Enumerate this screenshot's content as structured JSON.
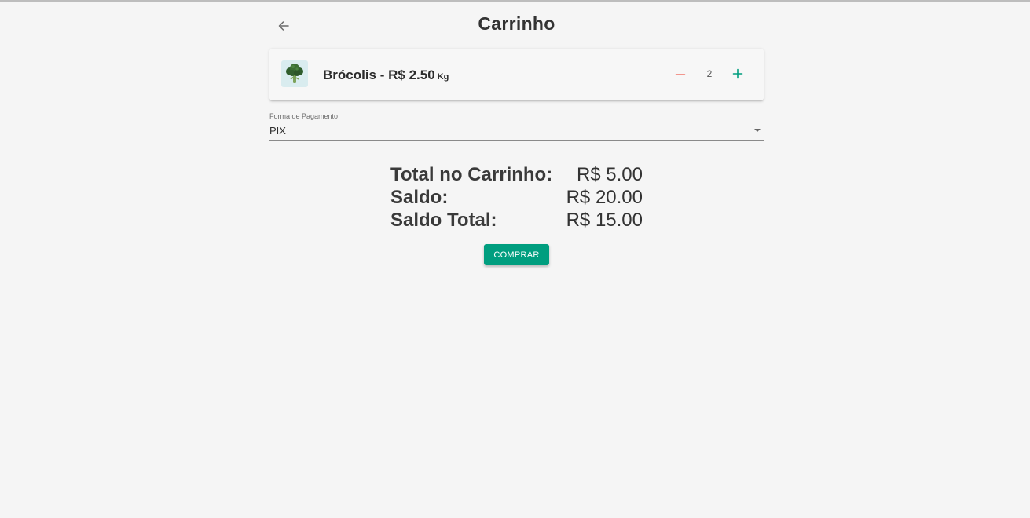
{
  "header": {
    "title": "Carrinho",
    "back_icon": "arrow-left-icon"
  },
  "cart": {
    "items": [
      {
        "name_price": "Brócolis - R$ 2.50",
        "unit": "Kg",
        "quantity": "2",
        "image_icon": "broccoli-icon"
      }
    ]
  },
  "payment": {
    "label": "Forma de Pagamento",
    "selected": "PIX"
  },
  "totals": {
    "cart_total_label": "Total no Carrinho:",
    "cart_total_value": "R$ 5.00",
    "balance_label": "Saldo:",
    "balance_value": "R$ 20.00",
    "final_balance_label": "Saldo Total:",
    "final_balance_value": "R$ 15.00"
  },
  "actions": {
    "buy_label": "COMPRAR"
  },
  "colors": {
    "accent": "#009e7f",
    "minus": "#f0766b",
    "background": "#f5f5f5"
  }
}
